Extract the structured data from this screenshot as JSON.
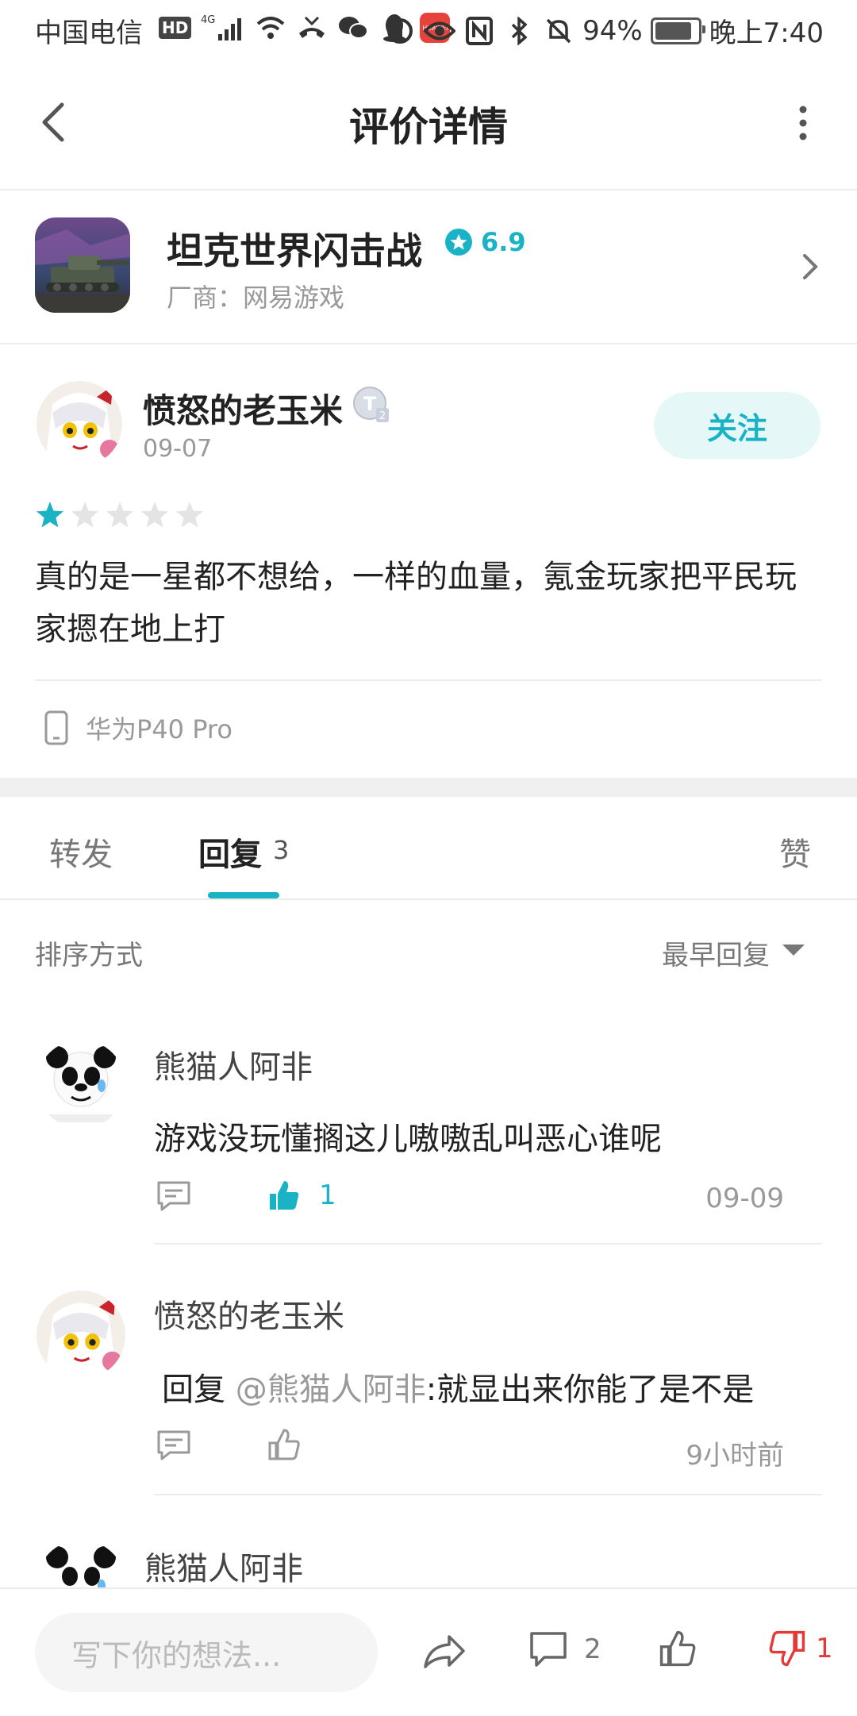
{
  "status_bar": {
    "carrier": "中国电信",
    "hd": "HD",
    "network": "4G",
    "app_badge": "HUAWEI",
    "battery": "94%",
    "battery_level": 0.94,
    "time": "晚上7:40"
  },
  "header": {
    "title": "评价详情"
  },
  "game": {
    "name": "坦克世界闪击战",
    "rating": "6.9",
    "vendor": "厂商：网易游戏"
  },
  "review": {
    "author": "愤怒的老玉米",
    "date": "09-07",
    "follow_label": "关注",
    "stars_filled": 1,
    "stars_total": 5,
    "text": "真的是一星都不想给，一样的血量，氪金玩家把平民玩家摁在地上打",
    "device": "华为P40 Pro"
  },
  "tabs": {
    "repost": "转发",
    "reply": "回复",
    "reply_count": "3",
    "like": "赞"
  },
  "sort": {
    "label": "排序方式",
    "value": "最早回复"
  },
  "replies": [
    {
      "name": "熊猫人阿非",
      "text": "游戏没玩懂搁这儿嗷嗷乱叫恶心谁呢",
      "like_count": "1",
      "time": "09-09",
      "liked": true
    },
    {
      "name": "愤怒的老玉米",
      "reply_prefix": "回复",
      "mention": "@熊猫人阿非",
      "text": ":就显出来你能了是不是",
      "time": "9小时前",
      "liked": false
    },
    {
      "name": "熊猫人阿非"
    }
  ],
  "bottom_bar": {
    "placeholder": "写下你的想法...",
    "comment_count": "2",
    "dislike_count": "1"
  },
  "colors": {
    "accent": "#1ab3c6",
    "dislike": "#e53935"
  }
}
